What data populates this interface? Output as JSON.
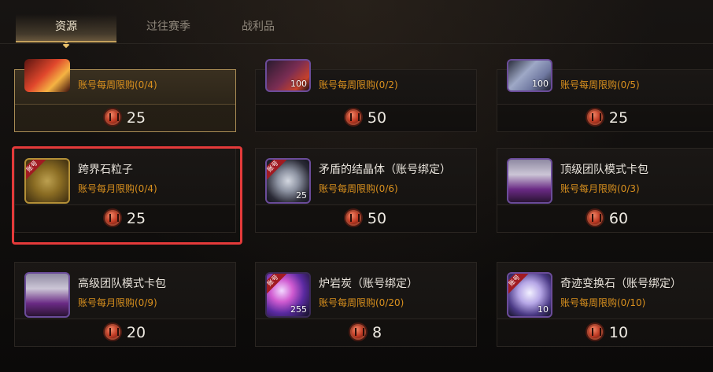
{
  "tabs": [
    {
      "label": "资源",
      "active": true
    },
    {
      "label": "过往赛季",
      "active": false
    },
    {
      "label": "战利品",
      "active": false
    }
  ],
  "items_row0": [
    {
      "limit": "账号每周限购(0/4)",
      "price": "25",
      "icon": "ember-chest-icon",
      "qty": ""
    },
    {
      "limit": "账号每周限购(0/2)",
      "price": "50",
      "icon": "dark-crystal-icon",
      "qty": "100"
    },
    {
      "limit": "账号每周限购(0/5)",
      "price": "25",
      "icon": "silver-chip-icon",
      "qty": "100"
    }
  ],
  "items_row1": [
    {
      "title": "跨界石粒子",
      "limit": "账号每月限购(0/4)",
      "price": "25",
      "icon": "stone-particles-icon",
      "qty": "",
      "ribbon": "账号"
    },
    {
      "title": "矛盾的结晶体（账号绑定）",
      "limit": "账号每周限购(0/6)",
      "price": "50",
      "icon": "crystal-icon",
      "qty": "25",
      "ribbon": "账号"
    },
    {
      "title": "顶级团队模式卡包",
      "limit": "账号每月限购(0/3)",
      "price": "60",
      "icon": "card-pack-icon",
      "qty": "",
      "ribbon": ""
    }
  ],
  "items_row2": [
    {
      "title": "高级团队模式卡包",
      "limit": "账号每月限购(0/9)",
      "price": "20",
      "icon": "card-pack-icon",
      "qty": "",
      "ribbon": ""
    },
    {
      "title": "炉岩炭（账号绑定）",
      "limit": "账号每周限购(0/20)",
      "price": "8",
      "icon": "lava-orb-icon",
      "qty": "255",
      "ribbon": "账号"
    },
    {
      "title": "奇迹变换石（账号绑定）",
      "limit": "账号每周限购(0/10)",
      "price": "10",
      "icon": "miracle-stone-icon",
      "qty": "10",
      "ribbon": "账号"
    }
  ],
  "colors": {
    "accent": "#c6a25d",
    "limit_text": "#d9901e",
    "highlight": "#e43a3a"
  }
}
